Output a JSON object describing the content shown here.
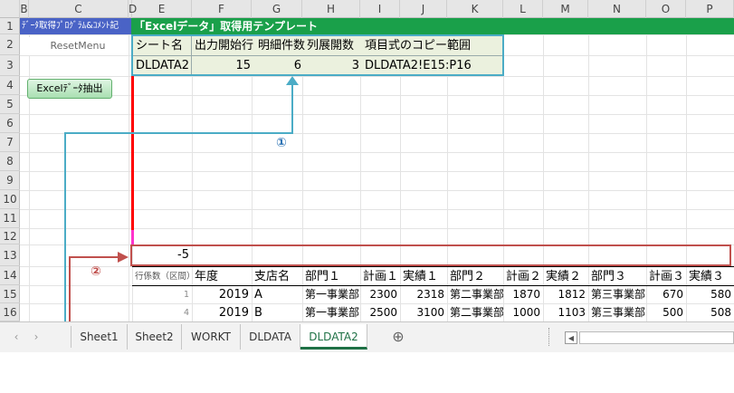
{
  "columns": [
    "B",
    "C",
    "D",
    "E",
    "F",
    "G",
    "H",
    "I",
    "J",
    "K",
    "L",
    "M",
    "N",
    "O",
    "P"
  ],
  "rows": [
    "1",
    "2",
    "3",
    "4",
    "5",
    "6",
    "7",
    "8",
    "9",
    "10",
    "11",
    "12",
    "13",
    "14",
    "15",
    "16"
  ],
  "program_label": "ﾃﾞｰﾀ取得ﾌﾟﾛｸﾞﾗﾑ&ｺﾒﾝﾄ記",
  "title": "「Excelデータ」取得用テンプレート",
  "buttons": {
    "reset": "ResetMenu",
    "excel": "Excelﾃﾞｰﾀ抽出"
  },
  "params": {
    "headers": [
      "シート名",
      "出力開始行",
      "明細件数",
      "列展開数",
      "項目式のコピー範囲"
    ],
    "values": [
      "DLDATA2",
      "15",
      "6",
      "3",
      "DLDATA2!E15:P16"
    ]
  },
  "row13_value": "-5",
  "markers": {
    "one": "①",
    "two": "②"
  },
  "table": {
    "headers": [
      "行係数（区間）",
      "年度",
      "支店名",
      "部門１",
      "計画１",
      "実績１",
      "部門２",
      "計画２",
      "実績２",
      "部門３",
      "計画３",
      "実績３"
    ],
    "rows": [
      [
        "1",
        "2019",
        "A",
        "第一事業部",
        "2300",
        "2318",
        "第二事業部",
        "1870",
        "1812",
        "第三事業部",
        "670",
        "580"
      ],
      [
        "4",
        "2019",
        "B",
        "第一事業部",
        "2500",
        "3100",
        "第二事業部",
        "1000",
        "1103",
        "第三事業部",
        "500",
        "508"
      ]
    ]
  },
  "tabs": [
    "Sheet1",
    "Sheet2",
    "WORKT",
    "DLDATA",
    "DLDATA2"
  ],
  "active_tab": "DLDATA2",
  "add_sheet_symbol": "⊕",
  "scroll_left_symbol": "◀",
  "nav_prev_symbol": "‹",
  "nav_next_symbol": "›",
  "colors": {
    "title_green": "#1aa04a",
    "params_bg": "#ebf1de",
    "cyan": "#4bacc6",
    "red_box": "#c0504d",
    "active_tab": "#1e7145"
  }
}
